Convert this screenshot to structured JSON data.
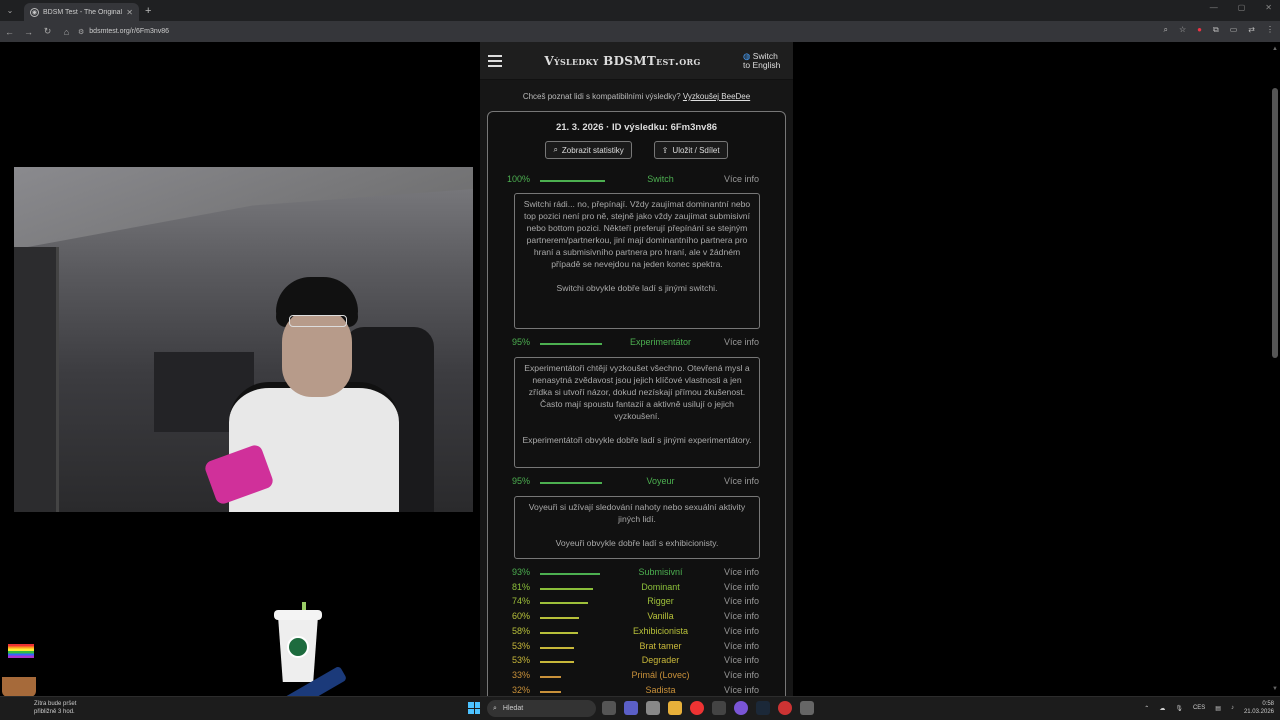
{
  "browser": {
    "tab_title": "BDSM Test - The Original BDSM",
    "url": "bdsmtest.org/r/6Fm3nv86"
  },
  "site": {
    "title": "Výsledky BDSMTest.org",
    "lang_switch_line1": "Switch",
    "lang_switch_line2": "to English",
    "promo_text": "Chceš poznat lidi s kompatibilními výsledky?",
    "promo_link": "Vyzkoušej BeeDee"
  },
  "result": {
    "date": "21. 3. 2026",
    "id_label": "ID výsledku:",
    "id_value": "6Fm3nv86",
    "stats_button": "Zobrazit statistiky",
    "share_button": "Uložit / Sdílet",
    "more_info": "Více info"
  },
  "traits": [
    {
      "percent": 100,
      "name": "Switch",
      "color": "#4caf50"
    },
    {
      "percent": 95,
      "name": "Experimentátor",
      "color": "#4caf50"
    },
    {
      "percent": 95,
      "name": "Voyeur",
      "color": "#4caf50"
    },
    {
      "percent": 93,
      "name": "Submisivní",
      "color": "#4caf50"
    },
    {
      "percent": 81,
      "name": "Dominant",
      "color": "#8bbf3a"
    },
    {
      "percent": 74,
      "name": "Rigger",
      "color": "#9ec03a"
    },
    {
      "percent": 60,
      "name": "Vanilla",
      "color": "#b7c03a"
    },
    {
      "percent": 58,
      "name": "Exhibicionista",
      "color": "#b7c03a"
    },
    {
      "percent": 53,
      "name": "Brat tamer",
      "color": "#c8b83a"
    },
    {
      "percent": 53,
      "name": "Degrader",
      "color": "#c8b83a"
    },
    {
      "percent": 33,
      "name": "Primál (Lovec)",
      "color": "#c9913a"
    },
    {
      "percent": 32,
      "name": "Sadista",
      "color": "#c9913a"
    }
  ],
  "descriptions": {
    "switch_p1": "Switchi rádi... no, přepínají. Vždy zaujímat dominantní nebo top pozici není pro ně, stejně jako vždy zaujímat submisivní nebo bottom pozici. Někteří preferují přepínání se stejným partnerem/partnerkou, jiní mají dominantního partnera pro hraní a submisivního partnera pro hraní, ale v žádném případě se nevejdou na jeden konec spektra.",
    "switch_p2": "Switchi obvykle dobře ladí s jinými switchi.",
    "experimenter_p1": "Experimentátoři chtějí vyzkoušet všechno. Otevřená mysl a nenasytná zvědavost jsou jejich klíčové vlastnosti a jen zřídka si utvoří názor, dokud nezískají přímou zkušenost. Často mají spoustu fantazií a aktivně usilují o jejich vyzkoušení.",
    "experimenter_p2": "Experimentátoři obvykle dobře ladí s jinými experimentátory.",
    "voyeur_p1": "Voyeuři si užívají sledování nahoty nebo sexuální aktivity jiných lidí.",
    "voyeur_p2": "Voyeuři obvykle dobře ladí s exhibicionisty."
  },
  "taskbar": {
    "weather_line1": "Zítra bude pršet",
    "weather_line2": "přibližně 3 hod.",
    "search_placeholder": "Hledat",
    "lang": "CES",
    "time": "0:58",
    "date": "21.03.2026"
  }
}
